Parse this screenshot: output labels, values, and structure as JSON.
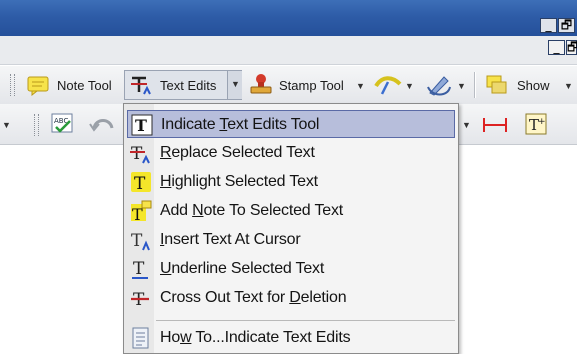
{
  "window": {
    "minimize_label": "_",
    "restore_label": "🗗"
  },
  "toolbar1": {
    "note_tool": "Note Tool",
    "text_edits": "Text Edits",
    "stamp_tool": "Stamp Tool",
    "show": "Show"
  },
  "menu": {
    "items": [
      {
        "pre": "Indicate ",
        "key": "T",
        "post": "ext Edits Tool",
        "icon": "indicate-text-edits-icon"
      },
      {
        "pre": "",
        "key": "R",
        "post": "eplace Selected Text",
        "icon": "replace-text-icon"
      },
      {
        "pre": "",
        "key": "H",
        "post": "ighlight Selected Text",
        "icon": "highlight-text-icon"
      },
      {
        "pre": "Add ",
        "key": "N",
        "post": "ote To Selected Text",
        "icon": "add-note-text-icon"
      },
      {
        "pre": "",
        "key": "I",
        "post": "nsert Text At Cursor",
        "icon": "insert-text-icon"
      },
      {
        "pre": "",
        "key": "U",
        "post": "nderline Selected Text",
        "icon": "underline-text-icon"
      },
      {
        "pre": "Cross Out Text for ",
        "key": "D",
        "post": "eletion",
        "icon": "cross-out-text-icon"
      },
      {
        "pre": "Ho",
        "key": "w",
        "post": " To...Indicate Text Edits",
        "icon": "how-to-icon"
      }
    ]
  },
  "colors": {
    "titlebar": "#2e5ca7",
    "highlight": "#b7bedb",
    "menu_bg": "#f4f4f4"
  }
}
